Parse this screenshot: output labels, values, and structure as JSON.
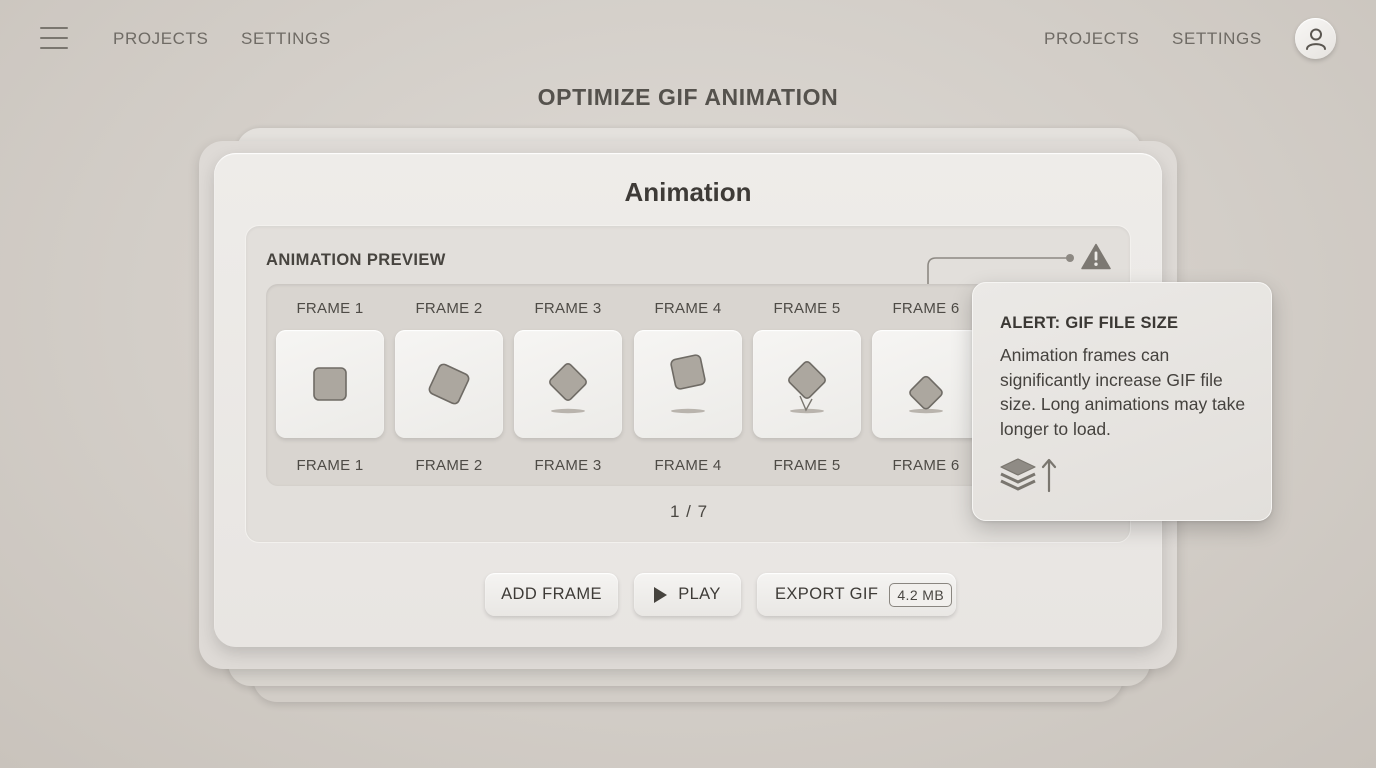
{
  "nav": {
    "left_links": [
      "PROJECTS",
      "SETTINGS"
    ],
    "right_links": [
      "PROJECTS",
      "SETTINGS"
    ],
    "menu_icon": "hamburger-menu-icon",
    "avatar_icon": "user-icon"
  },
  "page": {
    "title": "OPTIMIZE GIF ANIMATION"
  },
  "card": {
    "title": "Animation",
    "preview": {
      "label": "ANIMATION PREVIEW",
      "warning_icon": "warning-triangle-icon",
      "frames": [
        {
          "label_top": "FRAME 1",
          "label_bottom": "FRAME 1"
        },
        {
          "label_top": "FRAME 2",
          "label_bottom": "FRAME 2"
        },
        {
          "label_top": "FRAME 3",
          "label_bottom": "FRAME 3"
        },
        {
          "label_top": "FRAME 4",
          "label_bottom": "FRAME 4"
        },
        {
          "label_top": "FRAME 5",
          "label_bottom": "FRAME 5"
        },
        {
          "label_top": "FRAME 6",
          "label_bottom": "FRAME 6"
        }
      ],
      "pager": "1 / 7"
    },
    "buttons": {
      "add_frame": "ADD FRAME",
      "play": "PLAY",
      "export": "EXPORT GIF",
      "export_size": "4.2 MB"
    }
  },
  "alert": {
    "title": "ALERT: GIF FILE SIZE",
    "body": "Animation frames can significantly increase GIF file size. Long animations may take longer to load.",
    "icon": "layers-size-up-icon"
  },
  "colors": {
    "background": "#d3cec8",
    "card": "#eeece9",
    "text": "#3c3a37",
    "shape_fill": "#a9a49d"
  }
}
